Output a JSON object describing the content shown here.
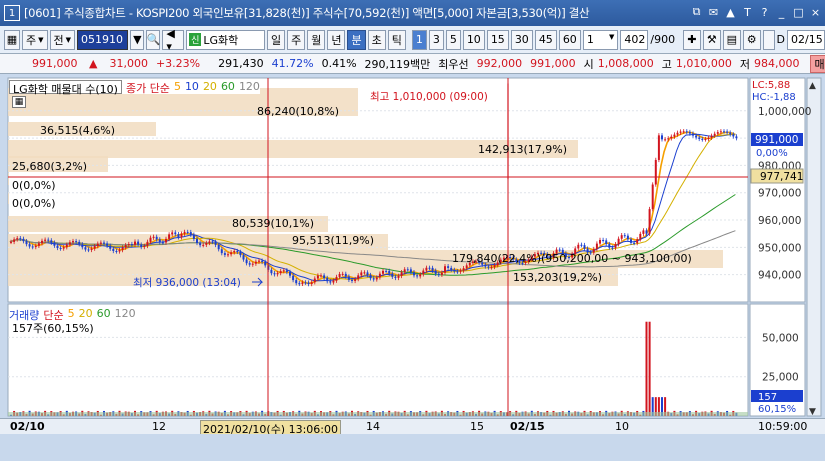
{
  "window": {
    "num": "1",
    "title": "[0601] 주식종합차트 - KOSPI200 외국인보유[31,828(천)] 주식수[70,592(천)] 액면[5,000] 자본금[3,530(억)] 결산",
    "buttons": [
      "⧉",
      "✉",
      "▲",
      "T",
      "?",
      "_",
      "□",
      "×"
    ]
  },
  "toolbar": {
    "type1": "주",
    "type2": "전",
    "code": "051910",
    "badge": "신",
    "name": "LG화학",
    "periods": [
      "일",
      "주",
      "월",
      "년",
      "분",
      "초",
      "틱"
    ],
    "active_period": "분",
    "intervals": [
      "1",
      "3",
      "5",
      "10",
      "15",
      "30",
      "45",
      "60"
    ],
    "active_interval": "1",
    "multiplier": "1",
    "count": "402",
    "count_total": "/900",
    "d_label": "D",
    "date": "02/15"
  },
  "pricebar": {
    "price": "991,000",
    "change": "31,000",
    "pct": "+3.23%",
    "volume": "291,430",
    "vol_ratio": "41.72%",
    "pct2": "0.41%",
    "amount": "290,119백만",
    "best_ask_label": "최우선",
    "best_ask": "992,000",
    "best_bid": "991,000",
    "open_label": "시",
    "open": "1,008,000",
    "high_label": "고",
    "high": "1,010,000",
    "low_label": "저",
    "low": "984,000",
    "order_btn": "매수"
  },
  "legend": {
    "stock": "LG화학 매물대 수(10)",
    "ma_label": "종가 단순",
    "ma_periods": [
      "5",
      "10",
      "20",
      "60",
      "120"
    ],
    "vol_title": "거래량",
    "vol_ma_label": "단순",
    "vol_info": "157주(60,15%)"
  },
  "annotations": {
    "high": "최고 1,010,000 (09:00)",
    "low": "최저 936,000 (13:04)",
    "lc": "LC:5,88",
    "hc": "HC:-1,88",
    "band_labels": [
      "86,240(10,8%)",
      "36,515(4,6%)",
      "142,913(17,9%)",
      "25,680(3,2%)",
      "0(0,0%)",
      "0(0,0%)",
      "80,539(10,1%)",
      "95,513(11,9%)",
      "179,840(22,4%)(950,200,00 ~ 943,100,00)",
      "153,203(19,2%)"
    ]
  },
  "yaxis": {
    "price_ticks": [
      "1,000,000",
      "990,000",
      "980,000",
      "970,000",
      "960,000",
      "950,000",
      "940,000"
    ],
    "current_price": "991,000",
    "current_pct": "0,00%",
    "cursor_price": "977,741",
    "volume_ticks": [
      "50,000",
      "25,000"
    ],
    "vol_current": "157",
    "vol_pct": "60,15%"
  },
  "xaxis": {
    "labels": [
      "02/10",
      "12",
      "14",
      "15",
      "02/15",
      "10"
    ],
    "cursor": "2021/02/10(수) 13:06:00",
    "time": "10:59:00"
  },
  "colors": {
    "ma5": "#f5a000",
    "ma10": "#1b3fcf",
    "ma20": "#d4b000",
    "ma60": "#2a9a2a",
    "ma120": "#888888",
    "candle_up": "#d2141e",
    "candle_down": "#1b3fcf",
    "band": "#f1dcc0",
    "cursor": "#d2141e"
  }
}
